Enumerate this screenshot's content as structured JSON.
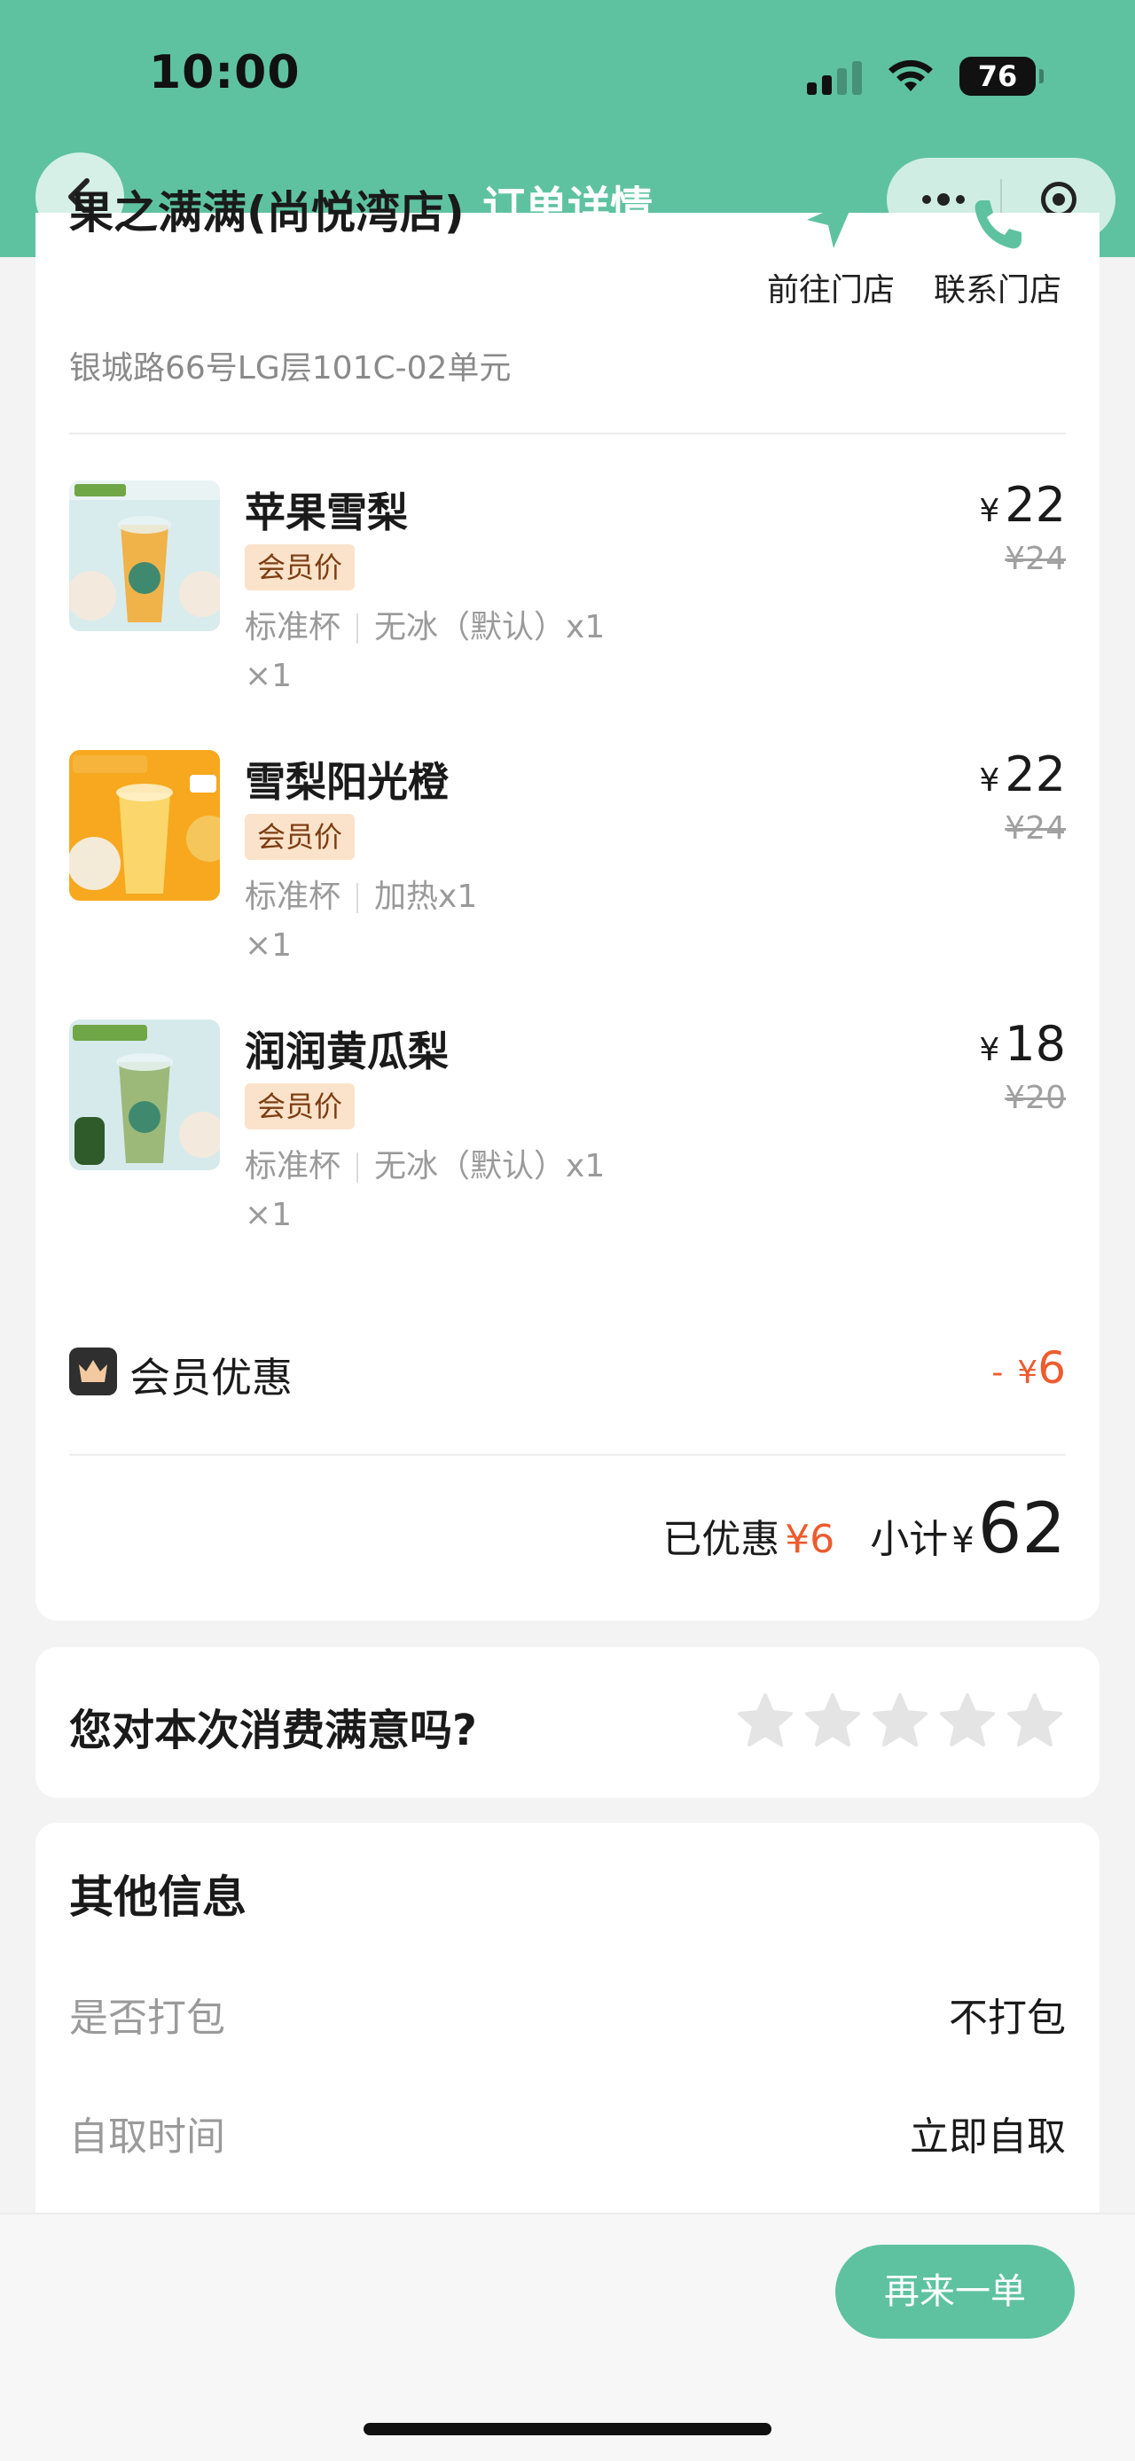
{
  "status_bar": {
    "time": "10:00",
    "battery": "76"
  },
  "nav": {
    "title": "订单详情"
  },
  "store": {
    "name": "果之满满(尚悦湾店)",
    "address": "银城路66号LG层101C-02单元",
    "goto_label": "前往门店",
    "contact_label": "联系门店"
  },
  "items": [
    {
      "name": "苹果雪梨",
      "tag": "会员价",
      "spec1": "标准杯",
      "spec2": "无冰（默认）x1",
      "qty": "×1",
      "price_symbol": "¥",
      "price": "22",
      "orig_price": "¥24",
      "thumb_colors": [
        "#f0b34a",
        "#cfe6e8"
      ]
    },
    {
      "name": "雪梨阳光橙",
      "tag": "会员价",
      "spec1": "标准杯",
      "spec2": "加热x1",
      "qty": "×1",
      "price_symbol": "¥",
      "price": "22",
      "orig_price": "¥24",
      "thumb_colors": [
        "#f6a21a",
        "#f7b733"
      ]
    },
    {
      "name": "润润黄瓜梨",
      "tag": "会员价",
      "spec1": "标准杯",
      "spec2": "无冰（默认）x1",
      "qty": "×1",
      "price_symbol": "¥",
      "price": "18",
      "orig_price": "¥20",
      "thumb_colors": [
        "#8fae6a",
        "#cfe6e8"
      ]
    }
  ],
  "member_discount": {
    "label": "会员优惠",
    "prefix": "-",
    "symbol": "¥",
    "amount": "6"
  },
  "totals": {
    "discount_label": "已优惠",
    "discount_value": "¥6",
    "subtotal_label": "小计",
    "symbol": "¥",
    "subtotal": "62"
  },
  "rating": {
    "question": "您对本次消费满意吗?",
    "stars_filled": 0,
    "stars_total": 5
  },
  "info": {
    "title": "其他信息",
    "rows": [
      {
        "key": "是否打包",
        "value": "不打包"
      },
      {
        "key": "自取时间",
        "value": "立即自取"
      }
    ]
  },
  "actions": {
    "reorder": "再来一单"
  },
  "colors": {
    "brand": "#5ec2a1",
    "accent": "#ee5b2e",
    "tag_bg": "#fbe3cb"
  }
}
